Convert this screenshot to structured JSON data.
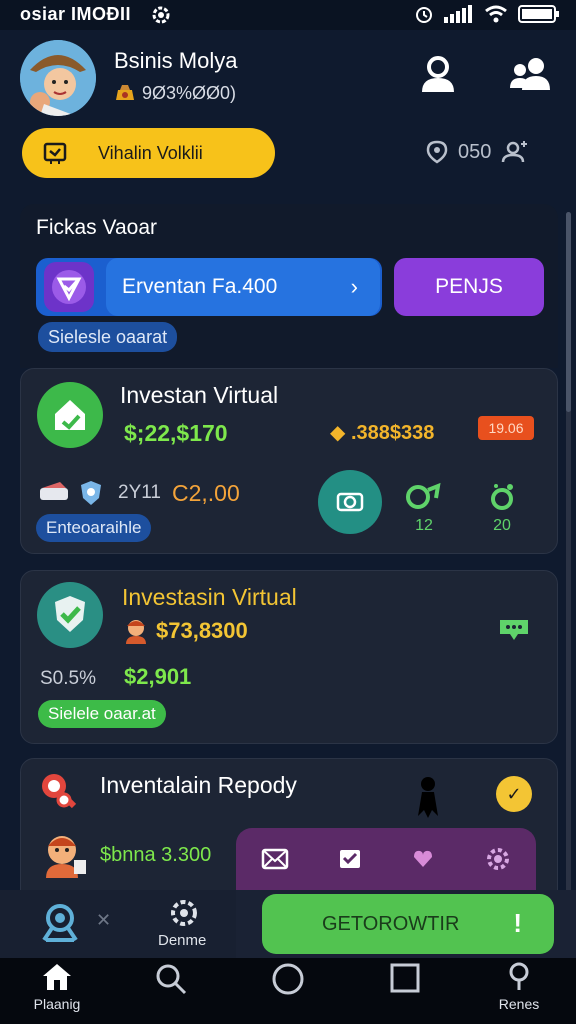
{
  "status_bar": {
    "left_text": "osiar IMOĐII"
  },
  "header": {
    "user_name": "Bsinis Molya",
    "balance": "9Ø3%ØØ0)",
    "yellow_button": "Vihalin Volklii",
    "counter": "050"
  },
  "section": {
    "title": "Fickas Vaoar",
    "blue_button": "Erventan Fa.400",
    "purple_button": "PENJS",
    "chip": "Sielesle oaarat"
  },
  "card1": {
    "title": "Investan Virtual",
    "value": "$;22,$170",
    "coins": ".388$338",
    "badge": "19.06",
    "small_value": "2Y11",
    "orange_value": "C2,.00",
    "green1_label": "12",
    "green2_label": "20",
    "chip": "Enteoaraihle"
  },
  "card2": {
    "title": "Investasin Virtual",
    "value": "$73,8300",
    "percent": "S0.5%",
    "green_value": "$2,901",
    "chip": "Sielele oaar.at"
  },
  "card3": {
    "title": "Inventalain Repody",
    "value": "$bnna 3.300"
  },
  "action_bar": {
    "gear_label": "Denme",
    "cta": "GETOROWTIR",
    "cta_mark": "!"
  },
  "nav": {
    "items": [
      {
        "label": "Plaanig",
        "icon": "home-icon"
      },
      {
        "label": "",
        "icon": "search-icon"
      },
      {
        "label": "",
        "icon": "circle-icon"
      },
      {
        "label": "",
        "icon": "square-icon"
      },
      {
        "label": "Renes",
        "icon": "pin-icon"
      }
    ]
  },
  "colors": {
    "background": "#0f1a2e",
    "yellow": "#f7c21a",
    "blue": "#2673e0",
    "purple": "#8a3ddb",
    "green": "#52c350",
    "accent_green_text": "#7ee84c",
    "orange": "#e8501e"
  }
}
